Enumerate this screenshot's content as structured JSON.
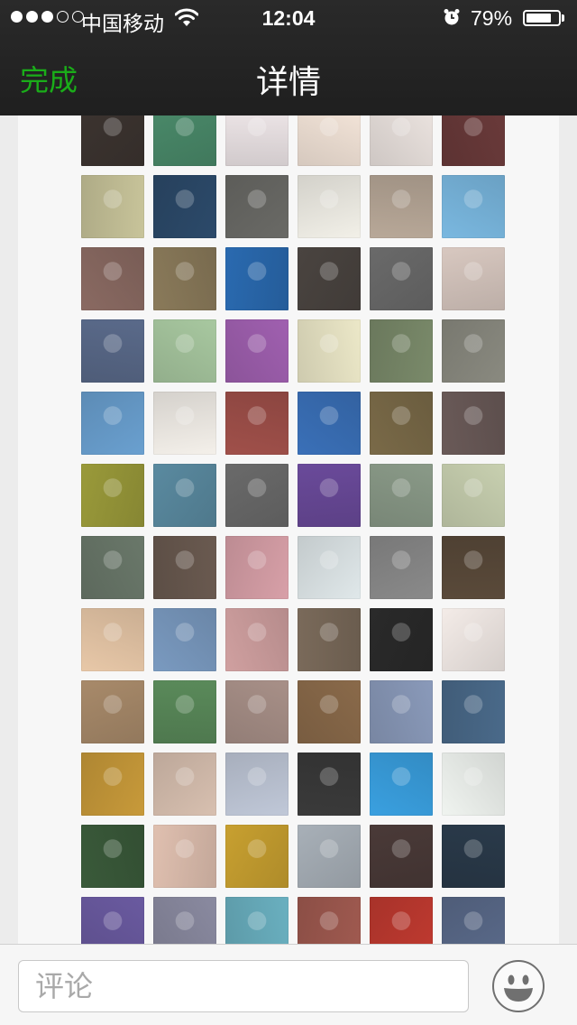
{
  "status_bar": {
    "carrier": "中国移动",
    "time": "12:04",
    "battery_percent": "79%",
    "battery_level": 0.79,
    "signal_strength": 3,
    "signal_max": 5
  },
  "nav": {
    "done_label": "完成",
    "title": "详情"
  },
  "comment": {
    "placeholder": "评论"
  },
  "icons": [
    "wifi-icon",
    "alarm-icon",
    "battery-icon",
    "emoji-icon"
  ],
  "colors": {
    "accent_green": "#1aad19",
    "topbar_bg": "#222222",
    "content_bg": "#f7f7f7"
  },
  "avatars": [
    [
      "#3c3430",
      "#4a8a6a",
      "#f0e8ea",
      "#f5e6da",
      "#ece4e0",
      "#6a3a3a"
    ],
    [
      "#c8c49a",
      "#2c4a6a",
      "#6a6a66",
      "#f2f0e8",
      "#b8a898",
      "#7ab8e0"
    ],
    [
      "#8a6a62",
      "#8a7a5a",
      "#2a6ab0",
      "#4a4440",
      "#6a6a6a",
      "#d8c8c0"
    ],
    [
      "#5a6a8a",
      "#a8c8a0",
      "#a060b0",
      "#ece8c8",
      "#7a8a6a",
      "#8a8a80"
    ],
    [
      "#6aa0d0",
      "#f4f0ea",
      "#a0504a",
      "#3a70b8",
      "#7a6a48",
      "#6a5a58"
    ],
    [
      "#9a9a3a",
      "#5a8aa0",
      "#6a6a6a",
      "#6a4a9a",
      "#8a9a88",
      "#c8d0b0"
    ],
    [
      "#6a786a",
      "#6a5a50",
      "#d8a0a8",
      "#e0e8ea",
      "#8a8a8a",
      "#5a4a3a"
    ],
    [
      "#e8c8a8",
      "#7a9ac0",
      "#d0a0a0",
      "#7a6a5a",
      "#2a2a2a",
      "#f4ece8"
    ],
    [
      "#a88a6a",
      "#5a8a5a",
      "#a89088",
      "#8a6a4a",
      "#8a9aba",
      "#4a6a8a"
    ],
    [
      "#c89a3a",
      "#d8c0b0",
      "#c0c8d8",
      "#3a3a3a",
      "#3aa0e0",
      "#f0f4f0"
    ],
    [
      "#3a5a3a",
      "#e0c0b0",
      "#c8a030",
      "#a8b0b8",
      "#4a3a38",
      "#2a3a4a"
    ],
    [
      "#6a5aa0",
      "#8a8aa0",
      "#6ab0c0",
      "#a05a50",
      "#c03a30",
      "#5a6a8a"
    ]
  ]
}
